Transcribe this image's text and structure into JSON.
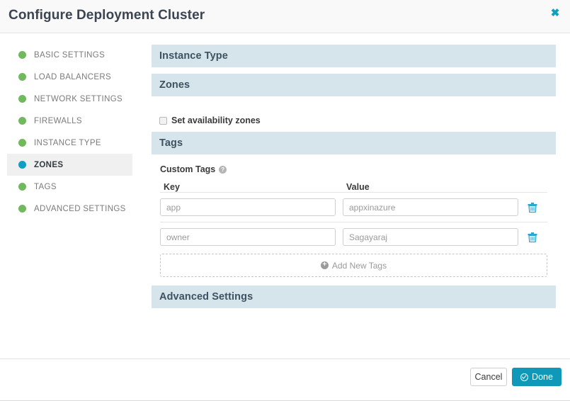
{
  "dialog": {
    "title": "Configure Deployment Cluster",
    "close_icon": "close-icon",
    "close_glyph": "✖"
  },
  "sidebar": {
    "items": [
      {
        "label": "BASIC SETTINGS",
        "state": "complete"
      },
      {
        "label": "LOAD BALANCERS",
        "state": "complete"
      },
      {
        "label": "NETWORK SETTINGS",
        "state": "complete"
      },
      {
        "label": "FIREWALLS",
        "state": "complete"
      },
      {
        "label": "INSTANCE TYPE",
        "state": "complete"
      },
      {
        "label": "ZONES",
        "state": "active"
      },
      {
        "label": "TAGS",
        "state": "complete"
      },
      {
        "label": "ADVANCED SETTINGS",
        "state": "complete"
      }
    ],
    "dot_color_complete": "#72b85e",
    "dot_color_active": "#0e9fc1"
  },
  "sections": {
    "instance_type": {
      "title": "Instance Type"
    },
    "zones": {
      "title": "Zones",
      "checkbox_label": "Set availability zones",
      "checkbox_checked": false
    },
    "tags": {
      "title": "Tags",
      "custom_tags_label": "Custom Tags",
      "help_icon": "help-icon",
      "help_glyph": "?",
      "columns": {
        "key": "Key",
        "value": "Value"
      },
      "rows": [
        {
          "key": "app",
          "value": "appxinazure",
          "delete_icon": "trash-icon"
        },
        {
          "key": "owner",
          "value": "Sagayaraj",
          "delete_icon": "trash-icon"
        }
      ],
      "add_button_label": "Add New Tags",
      "add_button_icon": "plus-circle-icon"
    },
    "advanced_settings": {
      "title": "Advanced Settings"
    }
  },
  "footer": {
    "cancel_label": "Cancel",
    "done_label": "Done",
    "done_icon": "check-circle-icon"
  },
  "colors": {
    "accent_teal": "#1098b8",
    "section_header_bg": "#d6e5eb",
    "section_header_text": "#3f5261",
    "green": "#72b85e"
  }
}
